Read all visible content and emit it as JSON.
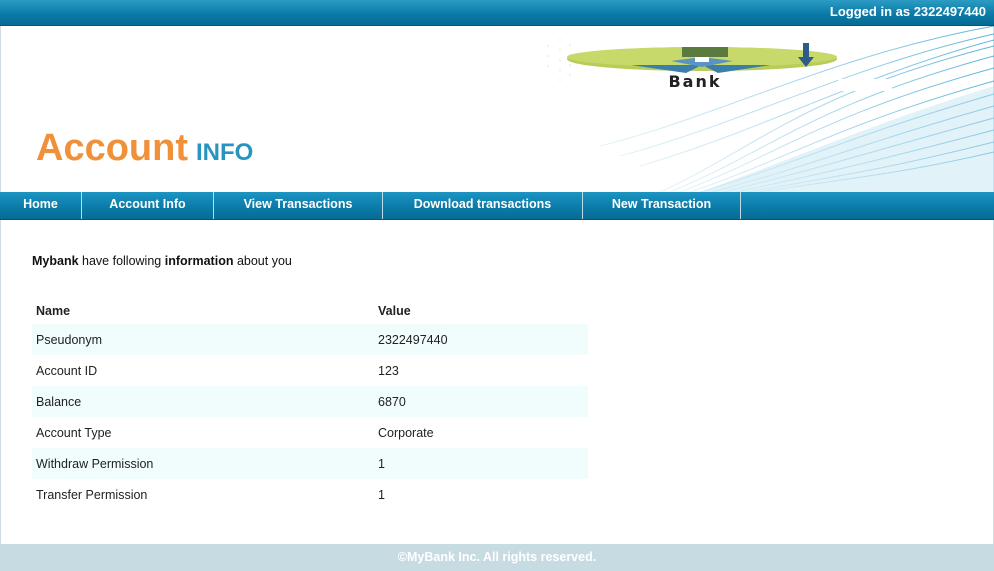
{
  "topbar": {
    "logged_in_text": "Logged in as 2322497440"
  },
  "logo": {
    "text": "Bank"
  },
  "title": {
    "main": "Account",
    "sub": "INFO"
  },
  "nav": [
    {
      "label": "Home"
    },
    {
      "label": "Account Info"
    },
    {
      "label": "View Transactions"
    },
    {
      "label": "Download transactions"
    },
    {
      "label": "New Transaction"
    }
  ],
  "intro": {
    "bank": "Mybank",
    "text1": " have following ",
    "info": "information",
    "text2": " about you"
  },
  "table": {
    "headers": [
      "Name",
      "Value"
    ],
    "rows": [
      {
        "name": "Pseudonym",
        "value": "2322497440"
      },
      {
        "name": "Account ID",
        "value": "123"
      },
      {
        "name": "Balance",
        "value": "6870"
      },
      {
        "name": "Account Type",
        "value": "Corporate"
      },
      {
        "name": "Withdraw Permission",
        "value": "1"
      },
      {
        "name": "Transfer Permission",
        "value": "1"
      }
    ]
  },
  "footer": {
    "text": "©MyBank Inc. All rights reserved."
  },
  "colors": {
    "accent_orange": "#f0913a",
    "accent_blue": "#2a94c0",
    "bar_blue": "#0b7ca9",
    "row_alt": "#f1fcfd"
  }
}
